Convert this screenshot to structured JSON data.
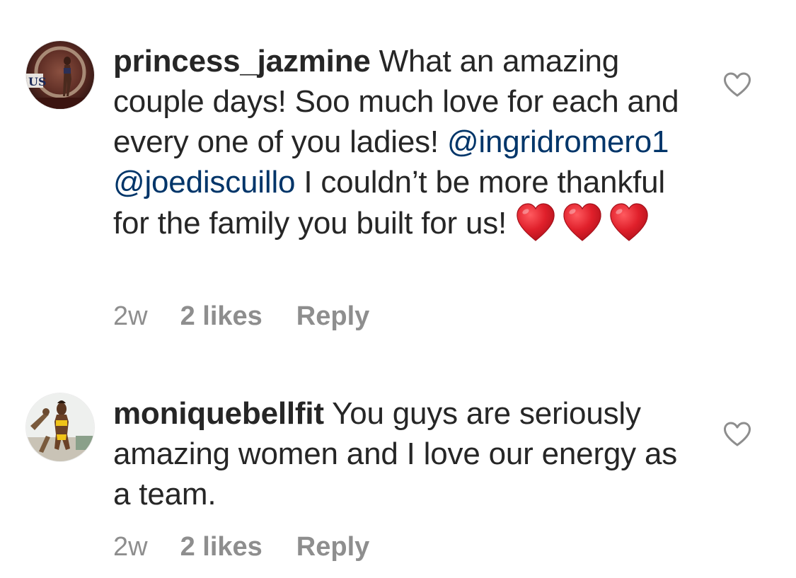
{
  "comments": [
    {
      "username": "princess_jazmine",
      "text_parts": [
        " What an amazing couple days! Soo much love for each and every one of you ladies! ",
        " I couldn’t be more thankful for the family you built for us! "
      ],
      "mentions": [
        "@ingridromero1",
        "@joediscuillo"
      ],
      "emoji": [
        "red-heart",
        "red-heart",
        "red-heart"
      ],
      "time": "2w",
      "likes": "2 likes",
      "reply_label": "Reply",
      "like_icon": "heart-outline-icon"
    },
    {
      "username": "moniquebellfit",
      "text": " You guys are seriously amazing women and I love our energy as a team.",
      "time": "2w",
      "likes": "2 likes",
      "reply_label": "Reply",
      "like_icon": "heart-outline-icon"
    }
  ],
  "colors": {
    "text": "#262626",
    "secondary": "#8e8e8e",
    "mention": "#003569",
    "emoji_heart": "#e0202b"
  }
}
